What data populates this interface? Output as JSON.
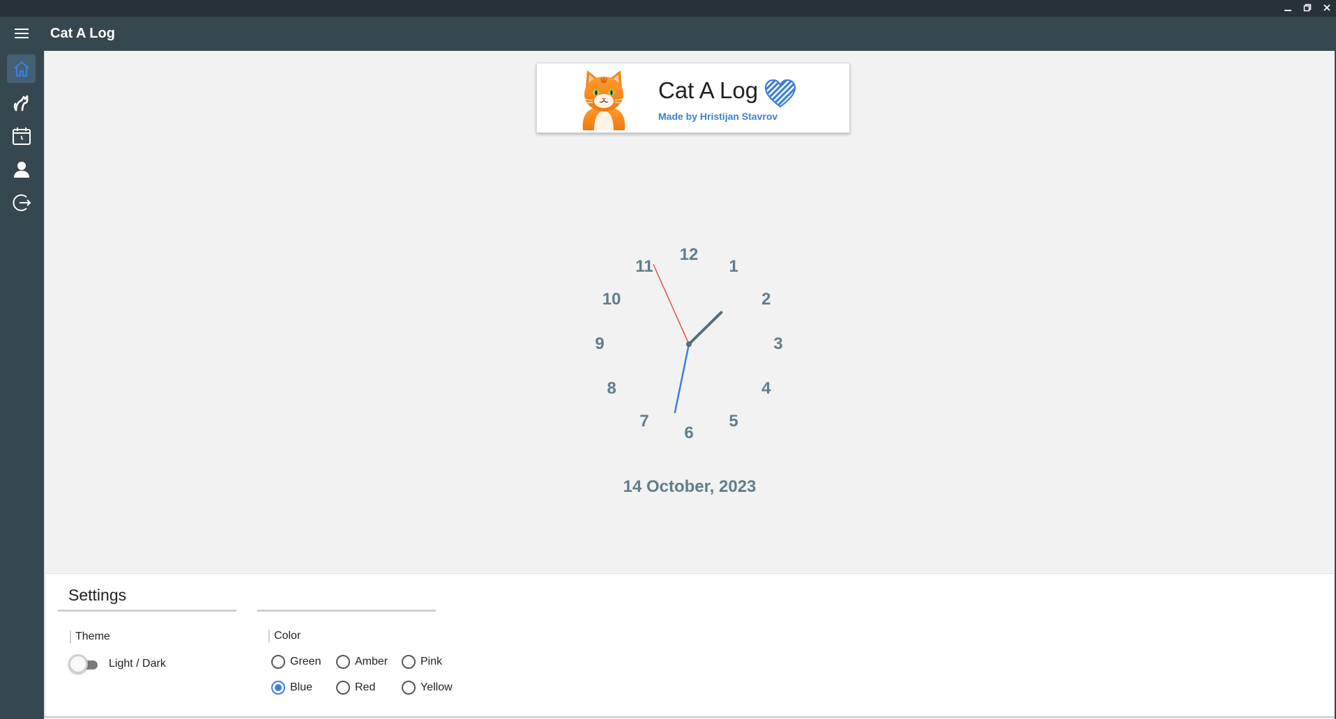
{
  "window": {
    "controls": [
      "minimize",
      "restore",
      "close"
    ]
  },
  "app": {
    "title": "Cat A Log",
    "accent": "#3d7fd9",
    "appbar_color": "#37474f"
  },
  "nav": {
    "items": [
      {
        "icon": "home-icon",
        "active": true
      },
      {
        "icon": "cat-icon",
        "active": false
      },
      {
        "icon": "calendar-clock-icon",
        "active": false
      },
      {
        "icon": "person-icon",
        "active": false
      },
      {
        "icon": "logout-icon",
        "active": false
      }
    ]
  },
  "header_card": {
    "title": "Cat A Log",
    "subtitle": "Made by Hristijan Stavrov",
    "logo_icon": "cat-face-icon",
    "decoration_icon": "heart-icon"
  },
  "clock": {
    "numbers": [
      "12",
      "1",
      "2",
      "3",
      "4",
      "5",
      "6",
      "7",
      "8",
      "9",
      "10",
      "11"
    ],
    "time": {
      "hour": 1,
      "minute": 31,
      "second": 56
    },
    "date": "14 October, 2023"
  },
  "settings": {
    "title": "Settings",
    "theme": {
      "label": "Theme",
      "toggle_label": "Light / Dark",
      "dark": false
    },
    "color": {
      "label": "Color",
      "options": [
        {
          "label": "Green",
          "checked": false
        },
        {
          "label": "Amber",
          "checked": false
        },
        {
          "label": "Pink",
          "checked": false
        },
        {
          "label": "Blue",
          "checked": true
        },
        {
          "label": "Red",
          "checked": false
        },
        {
          "label": "Yellow",
          "checked": false
        }
      ]
    }
  }
}
